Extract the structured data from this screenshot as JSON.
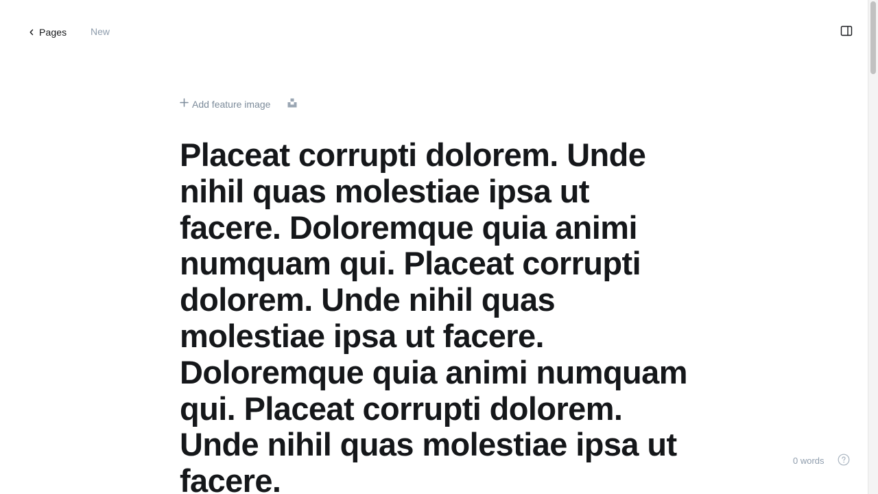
{
  "header": {
    "back_label": "Pages",
    "status": "New"
  },
  "feature": {
    "add_label": "Add feature image"
  },
  "editor": {
    "title": "Placeat corrupti dolorem. Unde nihil quas molestiae ipsa ut facere. Doloremque quia animi numquam qui. Placeat corrupti dolorem. Unde nihil quas molestiae ipsa ut facere. Doloremque quia animi numquam qui. Placeat corrupti dolorem. Unde nihil quas molestiae ipsa ut facere."
  },
  "footer": {
    "word_count": "0 words"
  },
  "icons": {
    "back": "chevron-left-icon",
    "sidebar": "sidebar-panel-icon",
    "add": "plus-icon",
    "unsplash": "unsplash-icon",
    "help": "help-circle-icon"
  }
}
